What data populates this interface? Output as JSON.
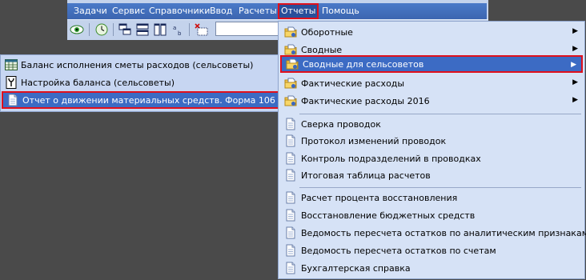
{
  "menubar": {
    "items": [
      {
        "label": "Задачи"
      },
      {
        "label": "Сервис"
      },
      {
        "label": "Справочники"
      },
      {
        "label": "Ввод"
      },
      {
        "label": "Расчеты"
      },
      {
        "label": "Отчеты"
      },
      {
        "label": "Помощь"
      }
    ]
  },
  "toolbar": {
    "buttons": [
      "eye-icon",
      "clock-icon",
      "cascade-windows-icon",
      "tile-horizontal-icon",
      "tile-vertical-icon",
      "sort-icon",
      "delete-grid-icon"
    ]
  },
  "left_panel": {
    "items": [
      {
        "label": "Баланс исполнения сметы расходов (сельсоветы)",
        "icon": "table-icon"
      },
      {
        "label": "Настройка баланса (сельсоветы)",
        "icon": "settings-doc-icon"
      },
      {
        "label": "Отчет о движении материальных средств. Форма 106",
        "icon": "document-icon",
        "selected": true
      }
    ]
  },
  "reports_menu": {
    "group1": [
      {
        "label": "Оборотные",
        "icon": "folder-icon",
        "submenu": true
      },
      {
        "label": "Сводные",
        "icon": "folder-icon",
        "submenu": true
      },
      {
        "label": "Сводные для сельсоветов",
        "icon": "folder-icon",
        "submenu": true,
        "highlighted": true
      },
      {
        "label": "Фактические расходы",
        "icon": "folder-icon",
        "submenu": true
      },
      {
        "label": "Фактические расходы 2016",
        "icon": "folder-icon",
        "submenu": true
      }
    ],
    "group2": [
      {
        "label": "Сверка проводок",
        "icon": "document-icon"
      },
      {
        "label": "Протокол изменений проводок",
        "icon": "document-icon"
      },
      {
        "label": "Контроль подразделений в проводках",
        "icon": "document-icon"
      },
      {
        "label": "Итоговая таблица расчетов",
        "icon": "document-icon"
      }
    ],
    "group3": [
      {
        "label": "Расчет процента восстановления",
        "icon": "document-icon"
      },
      {
        "label": "Восстановление бюджетных средств",
        "icon": "document-icon"
      },
      {
        "label": "Ведомость пересчета остатков по аналитическим признакам",
        "icon": "document-icon"
      },
      {
        "label": "Ведомость пересчета остатков по счетам",
        "icon": "document-icon"
      },
      {
        "label": "Бухгалтерская справка",
        "icon": "document-icon"
      }
    ]
  },
  "colors": {
    "highlight": "#3c6bc4",
    "outline": "#e0101c",
    "menubar": "#3f6cb8",
    "menu_bg": "#d6e2f6"
  }
}
